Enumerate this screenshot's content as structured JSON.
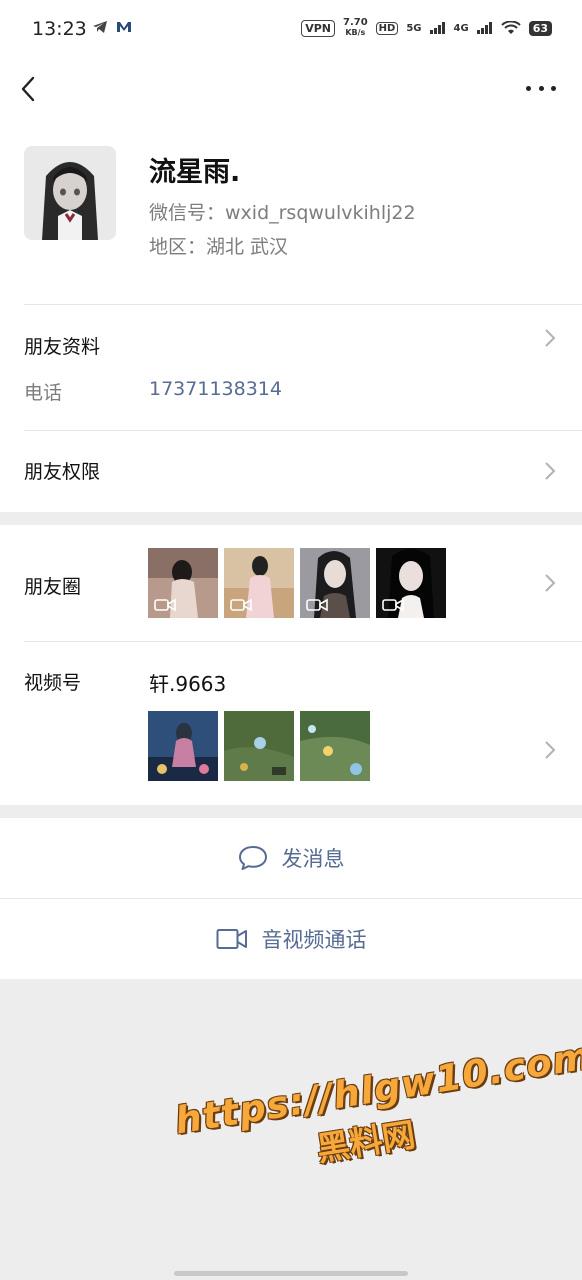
{
  "status_bar": {
    "time": "13:23",
    "vpn": "VPN",
    "speed_value": "7.70",
    "speed_unit": "KB/s",
    "hd": "HD",
    "net_5g": "5G",
    "net_4g": "4G",
    "battery": "63",
    "icons": [
      "telegram-icon",
      "mail-icon",
      "signal-icon",
      "wifi-icon",
      "battery-icon"
    ]
  },
  "navbar": {
    "back_icon": "back-chevron-icon",
    "more_icon": "more-dots-icon"
  },
  "profile": {
    "name": "流星雨.",
    "wechat_id": "微信号：wxid_rsqwulvkihlj22",
    "region": "地区：湖北  武汉"
  },
  "friend_info": {
    "title": "朋友资料",
    "phone_label": "电话",
    "phone_value": "17371138314"
  },
  "friend_permission": {
    "title": "朋友权限"
  },
  "moments": {
    "title": "朋友圈",
    "thumbs": [
      "video",
      "video",
      "video",
      "video"
    ]
  },
  "channels": {
    "title": "视频号",
    "channel_name": "轩.9663"
  },
  "actions": {
    "message": "发消息",
    "call": "音视频通话"
  },
  "watermark": {
    "line1": "https://hlgw10.com",
    "line2": "黑料网"
  },
  "colors": {
    "link": "#576b95",
    "secondary_text": "#7d7d7d",
    "background": "#ededed",
    "watermark": "#f7a83a"
  }
}
